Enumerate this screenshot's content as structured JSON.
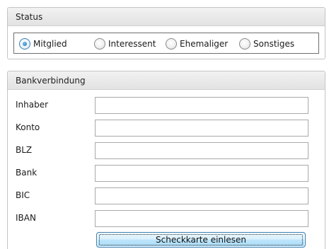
{
  "status": {
    "title": "Status",
    "options": [
      {
        "label": "Mitglied",
        "checked": true
      },
      {
        "label": "Interessent",
        "checked": false
      },
      {
        "label": "Ehemaliger",
        "checked": false
      },
      {
        "label": "Sonstiges",
        "checked": false
      }
    ]
  },
  "bank": {
    "title": "Bankverbindung",
    "fields": [
      {
        "label": "Inhaber",
        "value": ""
      },
      {
        "label": "Konto",
        "value": ""
      },
      {
        "label": "BLZ",
        "value": ""
      },
      {
        "label": "Bank",
        "value": ""
      },
      {
        "label": "BIC",
        "value": ""
      },
      {
        "label": "IBAN",
        "value": ""
      }
    ],
    "scan_button_label": "Scheckkarte einlesen"
  },
  "colors": {
    "accent": "#3c7fb1",
    "header_bg": "#e8e8e8"
  }
}
